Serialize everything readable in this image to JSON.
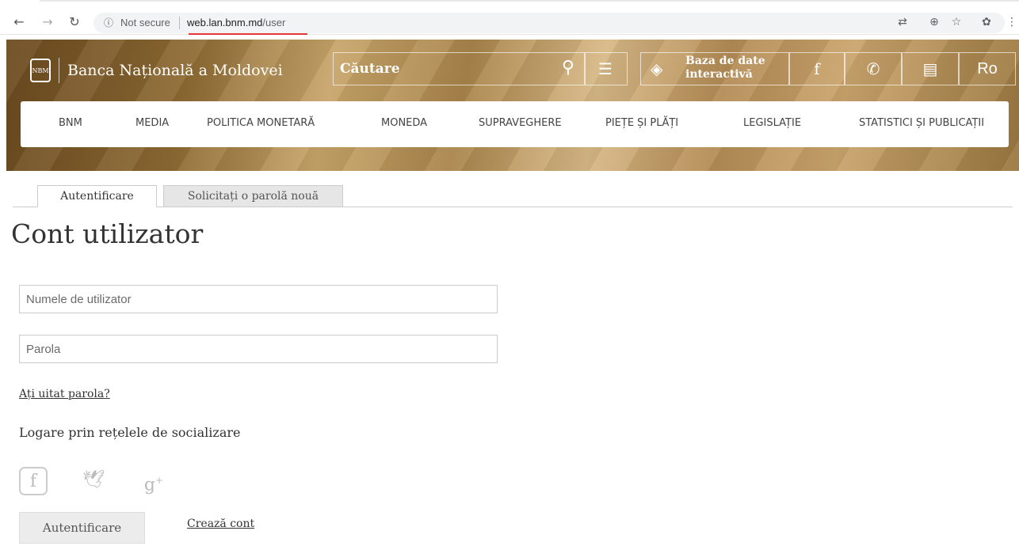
{
  "browser": {
    "not_secure": "Not secure",
    "url_host": "web.lan.bnm.md",
    "url_path": "/user"
  },
  "header": {
    "logo_mark": "NBM",
    "bank_name": "Banca Națională a Moldovei",
    "search_placeholder": "Căutare",
    "db_line1": "Baza de date",
    "db_line2": "interactivă",
    "language": "Ro"
  },
  "nav": {
    "items": [
      "BNM",
      "MEDIA",
      "POLITICA MONETARĂ",
      "MONEDA",
      "SUPRAVEGHERE",
      "PIEȚE ȘI PLĂȚI",
      "LEGISLAȚIE",
      "STATISTICI ȘI PUBLICAȚII"
    ]
  },
  "tabs": {
    "login": "Autentificare",
    "new_password": "Solicitați o parolă nouă"
  },
  "page": {
    "title": "Cont utilizator",
    "username_placeholder": "Numele de utilizator",
    "password_placeholder": "Parola",
    "forgot": "Ați uitat parola?",
    "social_title": "Logare prin rețelele de socializare",
    "submit": "Autentificare",
    "create": "Crează cont"
  }
}
